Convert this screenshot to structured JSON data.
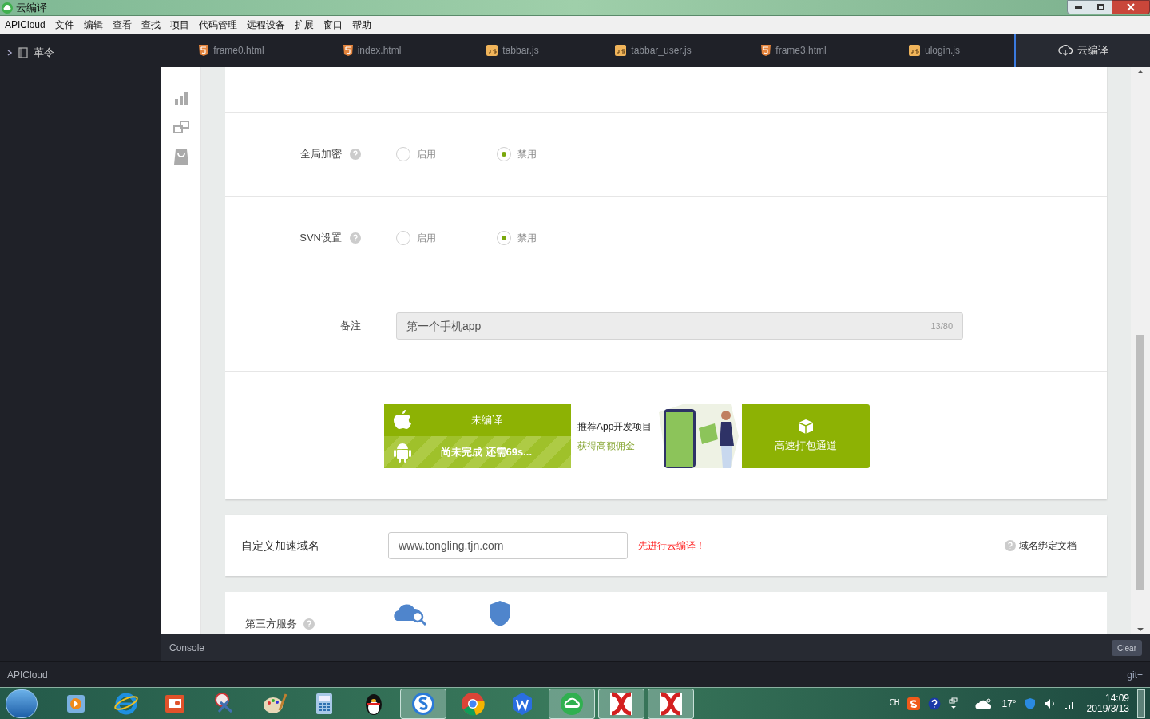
{
  "window": {
    "title": "云编译"
  },
  "menu": [
    "APICloud",
    "文件",
    "编辑",
    "查看",
    "查找",
    "项目",
    "代码管理",
    "远程设备",
    "扩展",
    "窗口",
    "帮助"
  ],
  "sidebar": {
    "items": [
      {
        "label": "革令",
        "expanded": false
      }
    ]
  },
  "tabs": [
    {
      "label": "frame0.html",
      "kind": "html"
    },
    {
      "label": "index.html",
      "kind": "html"
    },
    {
      "label": "tabbar.js",
      "kind": "js"
    },
    {
      "label": "tabbar_user.js",
      "kind": "js"
    },
    {
      "label": "frame3.html",
      "kind": "html"
    },
    {
      "label": "ulogin.js",
      "kind": "js"
    }
  ],
  "cloud_tab": {
    "label": "云编译",
    "selected": true
  },
  "settings": [
    {
      "label": "全局加密",
      "options": [
        {
          "label": "启用",
          "selected": false
        },
        {
          "label": "禁用",
          "selected": true
        }
      ]
    },
    {
      "label": "SVN设置",
      "options": [
        {
          "label": "启用",
          "selected": false
        },
        {
          "label": "禁用",
          "selected": true
        }
      ]
    }
  ],
  "note": {
    "label": "备注",
    "value": "第一个手机app",
    "counter": "13/80"
  },
  "build": {
    "ios_status": "未编译",
    "android_status": "尚未完成 还需69s...",
    "promo_title": "推荐App开发项目",
    "promo_subtitle": "获得高额佣金",
    "fast_channel": "高速打包通道"
  },
  "domain": {
    "label": "自定义加速域名",
    "value": "www.tongling.tjn.com",
    "warning": "先进行云编译！",
    "doc_link": "域名绑定文档"
  },
  "third_party": {
    "label": "第三方服务"
  },
  "console": {
    "title": "Console",
    "clear": "Clear"
  },
  "status_bar": {
    "left": "APICloud",
    "right": "git+"
  },
  "taskbar": {
    "apps": [
      {
        "kind": "player",
        "active": false
      },
      {
        "kind": "ie",
        "active": false
      },
      {
        "kind": "slides",
        "active": false
      },
      {
        "kind": "scissors",
        "active": false
      },
      {
        "kind": "paint",
        "active": false
      },
      {
        "kind": "calculator",
        "active": false
      },
      {
        "kind": "penguin",
        "active": false
      },
      {
        "kind": "s-browser",
        "active": true
      },
      {
        "kind": "chrome",
        "active": false
      },
      {
        "kind": "w-app",
        "active": false
      },
      {
        "kind": "cloud-app",
        "active": true
      },
      {
        "kind": "red-app",
        "active": true
      },
      {
        "kind": "red-app",
        "active": true
      }
    ],
    "tray": {
      "language": "CH",
      "weather": "17°",
      "time": "14:09",
      "date": "2019/3/13"
    }
  }
}
